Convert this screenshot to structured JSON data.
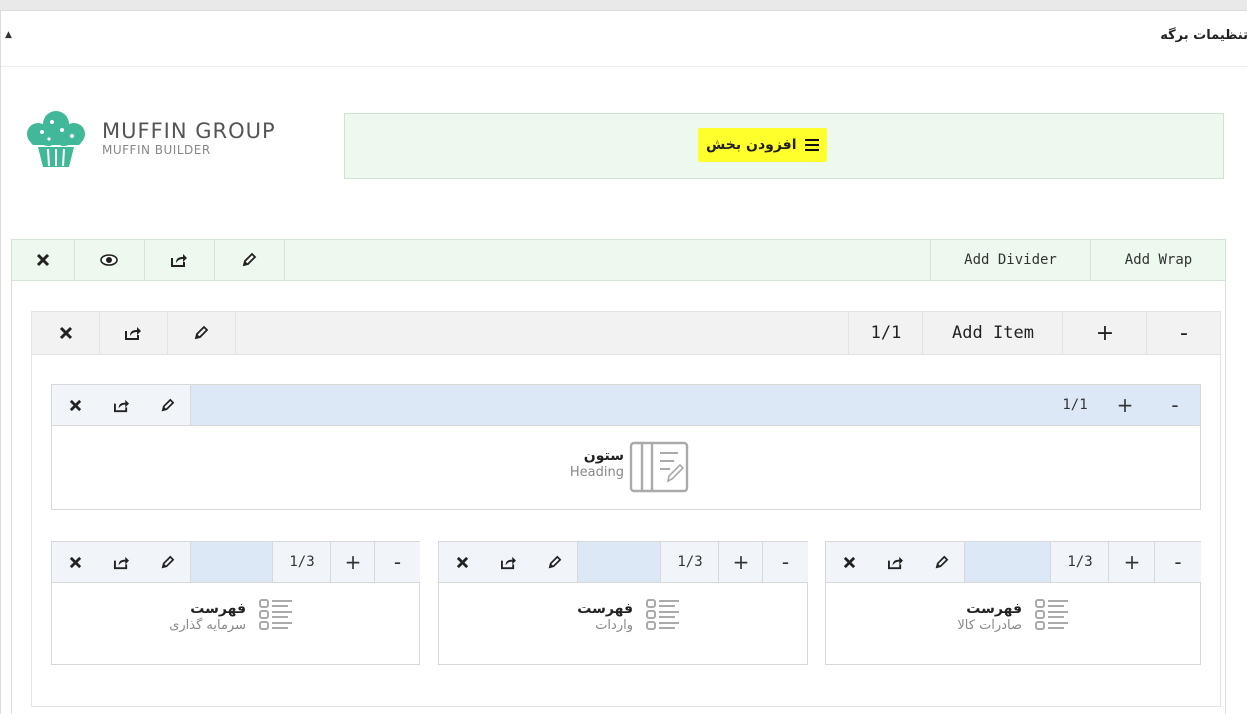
{
  "panel": {
    "title": "تنظیمات برگه",
    "toggle": "▲"
  },
  "logo": {
    "title": "MUFFIN GROUP",
    "subtitle": "MUFFIN BUILDER"
  },
  "add_section": {
    "label": "افزودن بخش"
  },
  "section_bar": {
    "add_divider": "Add Divider",
    "add_wrap": "Add Wrap"
  },
  "wrap_bar": {
    "size": "1/1",
    "add_item": "Add Item",
    "plus": "+",
    "minus": "-"
  },
  "heading_item": {
    "size": "1/1",
    "plus": "+",
    "minus": "-",
    "title": "ستون",
    "subtitle": "Heading"
  },
  "list_items": [
    {
      "size": "1/3",
      "plus": "+",
      "minus": "-",
      "title": "فهرست",
      "subtitle": "سرمایه گذاری"
    },
    {
      "size": "1/3",
      "plus": "+",
      "minus": "-",
      "title": "فهرست",
      "subtitle": "واردات"
    },
    {
      "size": "1/3",
      "plus": "+",
      "minus": "-",
      "title": "فهرست",
      "subtitle": "صادرات کالا"
    }
  ],
  "icons": {
    "delete": "close-icon",
    "visibility": "eye-icon",
    "export": "export-icon",
    "edit": "pencil-icon",
    "add_section": "menu-icon",
    "heading": "column-icon",
    "list": "list-icon"
  }
}
